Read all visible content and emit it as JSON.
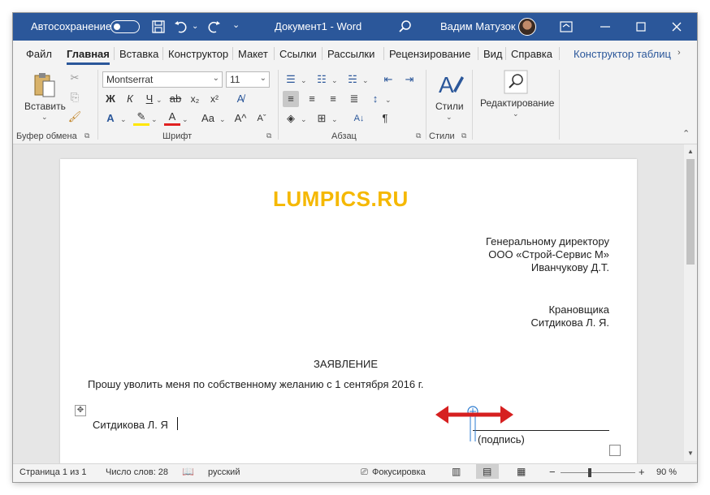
{
  "titlebar": {
    "autosave_label": "Автосохранение",
    "doc_title": "Документ1  -  Word",
    "user_name": "Вадим Матузок"
  },
  "menu": {
    "tabs": [
      "Файл",
      "Главная",
      "Вставка",
      "Конструктор",
      "Макет",
      "Ссылки",
      "Рассылки",
      "Рецензирование",
      "Вид",
      "Справка"
    ],
    "contextual_tab": "Конструктор таблиц"
  },
  "ribbon": {
    "clipboard": {
      "paste_label": "Вставить",
      "group_label": "Буфер обмена"
    },
    "font": {
      "font_name": "Montserrat",
      "font_size": "11",
      "group_label": "Шрифт",
      "bold": "Ж",
      "italic": "К",
      "underline": "Ч",
      "case_label": "Аа"
    },
    "paragraph": {
      "group_label": "Абзац"
    },
    "styles": {
      "label": "Стили",
      "group_label": "Стили"
    },
    "editing": {
      "label": "Редактирование"
    }
  },
  "document": {
    "logo": "LUMPICS.RU",
    "addressee": [
      "Генеральному директору",
      "ООО «Строй-Сервис М»",
      "Иванчукову Д.Т."
    ],
    "sender": [
      "Крановщика",
      "Ситдикова Л. Я."
    ],
    "heading": "ЗАЯВЛЕНИЕ",
    "body": "Прошу уволить меня по собственному желанию с 1 сентября 2016 г.",
    "signer": "Ситдикова Л. Я",
    "signature_label": "(подпись)"
  },
  "statusbar": {
    "page": "Страница 1 из 1",
    "words": "Число слов: 28",
    "language": "русский",
    "focus": "Фокусировка",
    "zoom": "90 %"
  },
  "colors": {
    "accent": "#2b579a",
    "logo": "#f5b800",
    "arrow": "#d62020"
  }
}
